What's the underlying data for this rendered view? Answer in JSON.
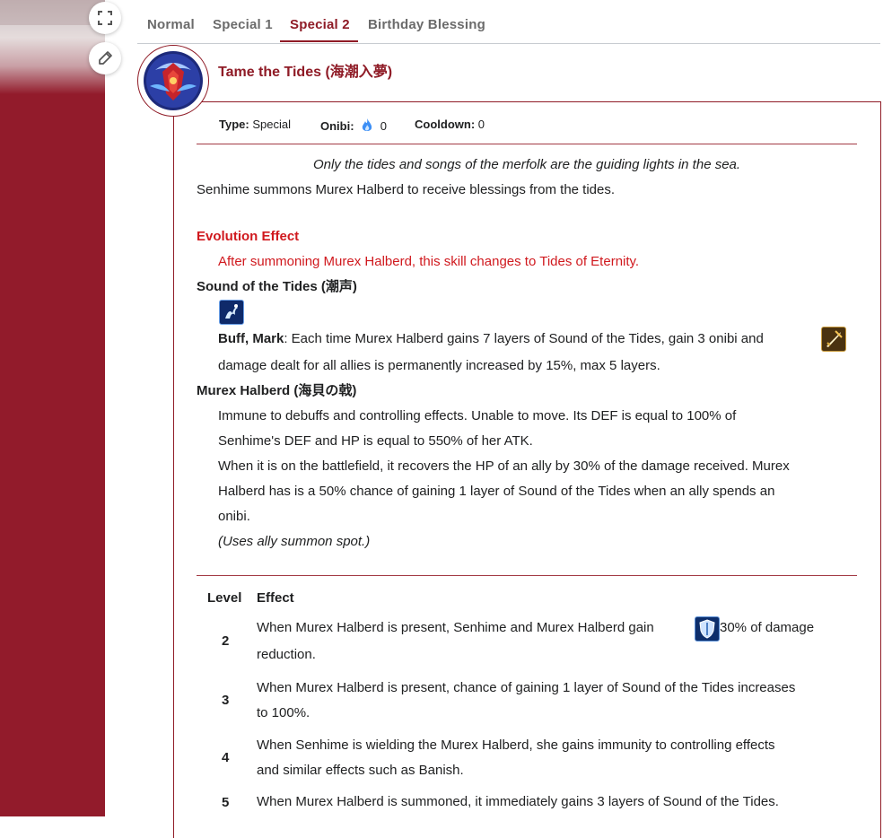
{
  "tabs": [
    "Normal",
    "Special 1",
    "Special 2",
    "Birthday Blessing"
  ],
  "skill": {
    "title": "Tame the Tides (海潮入夢)",
    "type_label": "Type:",
    "type_value": "Special",
    "onibi_label": "Onibi:",
    "onibi_value": "0",
    "cooldown_label": "Cooldown:",
    "cooldown_value": "0",
    "flavor": "Only the tides and songs of the merfolk are the guiding lights in the sea.",
    "description": "Senhime summons Murex Halberd to receive blessings from the tides.",
    "evolution_heading": "Evolution Effect",
    "evolution_text": "After summoning Murex Halberd, this skill changes to Tides of Eternity.",
    "sound_heading": "Sound of the Tides (潮声)",
    "buff_label": "Buff, Mark",
    "buff_text_1": ": Each time Murex Halberd gains 7 layers of Sound of the Tides, gain 3 onibi and",
    "buff_text_2": "damage dealt for all allies is permanently increased by 15%, max 5 layers.",
    "halberd_heading": "Murex Halberd (海貝の戟)",
    "halberd_lines": [
      "Immune to debuffs and controlling effects. Unable to move. Its DEF is equal to 100% of",
      "Senhime's DEF and HP is equal to 550% of her ATK.",
      "When it is on the battlefield, it recovers the HP of an ally by 30% of the damage received. Murex",
      "Halberd has is a 50% chance of gaining 1 layer of Sound of the Tides when an ally spends an",
      "onibi."
    ],
    "halberd_note": "(Uses ally summon spot.)"
  },
  "levels": {
    "col_level": "Level",
    "col_effect": "Effect",
    "rows": [
      {
        "level": "2",
        "line1": "When Murex Halberd is present, Senhime and Murex Halberd gain",
        "line1b": "30% of damage",
        "line2": "reduction."
      },
      {
        "level": "3",
        "line1": "When Murex Halberd is present, chance of gaining 1 layer of Sound of the Tides increases",
        "line2": "to 100%."
      },
      {
        "level": "4",
        "line1": "When Senhime is wielding the Murex Halberd, she gains immunity to controlling effects",
        "line2": "and similar effects such as Banish."
      },
      {
        "level": "5",
        "line1": "When Murex Halberd is summoned, it immediately gains 3 layers of Sound of the Tides."
      }
    ]
  },
  "icons": {
    "fullscreen": "fullscreen-icon",
    "edit": "pencil-icon",
    "onibi": "blue-flame-icon",
    "sound": "sound-of-tides-icon",
    "damage_up": "sword-buff-icon",
    "shield": "shield-icon"
  },
  "colors": {
    "accent": "#8f1b26",
    "evolution_red": "#d0191e",
    "left_panel": "#921b2b"
  }
}
